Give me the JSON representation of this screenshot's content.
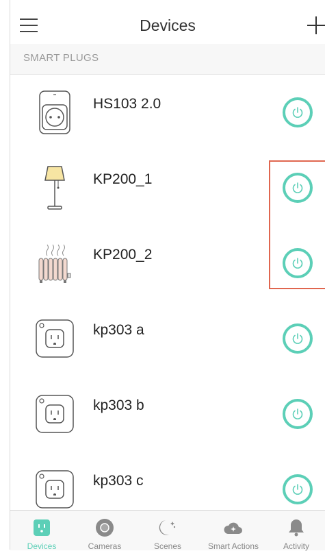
{
  "header": {
    "title": "Devices",
    "menu_icon": "hamburger-menu-icon",
    "add_icon": "plus-icon"
  },
  "section": {
    "label": "SMART PLUGS"
  },
  "devices": [
    {
      "name": "HS103 2.0",
      "icon": "wall-socket-icon",
      "power": "off"
    },
    {
      "name": "KP200_1",
      "icon": "floor-lamp-icon",
      "power": "off"
    },
    {
      "name": "KP200_2",
      "icon": "radiator-icon",
      "power": "off"
    },
    {
      "name": "kp303 a",
      "icon": "us-outlet-icon",
      "power": "off"
    },
    {
      "name": "kp303 b",
      "icon": "us-outlet-icon",
      "power": "off"
    },
    {
      "name": "kp303 c",
      "icon": "us-outlet-icon",
      "power": "off"
    }
  ],
  "tabs": [
    {
      "label": "Devices",
      "icon": "plug-icon",
      "active": true
    },
    {
      "label": "Cameras",
      "icon": "camera-icon",
      "active": false
    },
    {
      "label": "Scenes",
      "icon": "moon-stars-icon",
      "active": false
    },
    {
      "label": "Smart Actions",
      "icon": "cloud-sparkle-icon",
      "active": false
    },
    {
      "label": "Activity",
      "icon": "bell-icon",
      "active": false
    }
  ],
  "colors": {
    "accent": "#5ccfb7",
    "highlight_border": "#e0664f",
    "section_text": "#999999"
  }
}
